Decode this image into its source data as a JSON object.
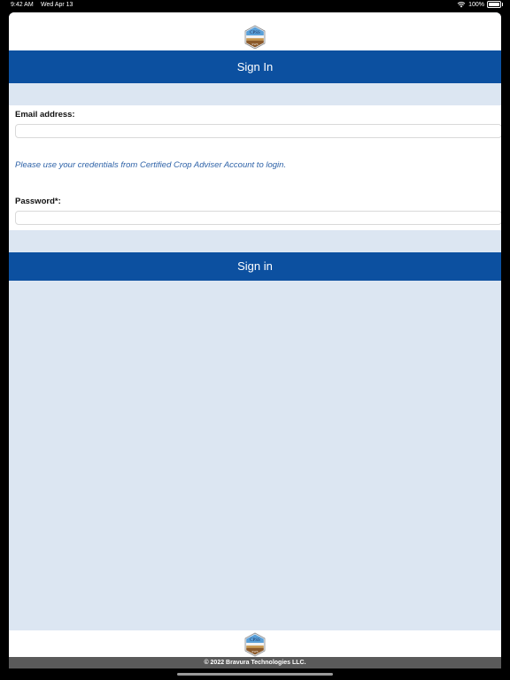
{
  "status_bar": {
    "time": "9:42 AM",
    "date": "Wed Apr 13",
    "battery_text": "100%"
  },
  "logo": {
    "text": "CPSS",
    "subtext": "SWS",
    "colors": {
      "top": "#5aa0d8",
      "band": "#c9974a",
      "bottom": "#8b5a2b"
    }
  },
  "header": {
    "title": "Sign In"
  },
  "form": {
    "email_label": "Email address:",
    "email_value": "",
    "hint": "Please use your credentials from Certified Crop Adviser Account to login.",
    "password_label": "Password*:",
    "password_value": ""
  },
  "signin_button": {
    "label": "Sign in"
  },
  "footer": {
    "copyright": "© 2022 Bravura Technologies LLC."
  },
  "colors": {
    "brand_blue": "#0c50a0",
    "page_background": "#dce6f2",
    "hint_text": "#2f63a8",
    "footer_background": "#5a5a5a"
  }
}
